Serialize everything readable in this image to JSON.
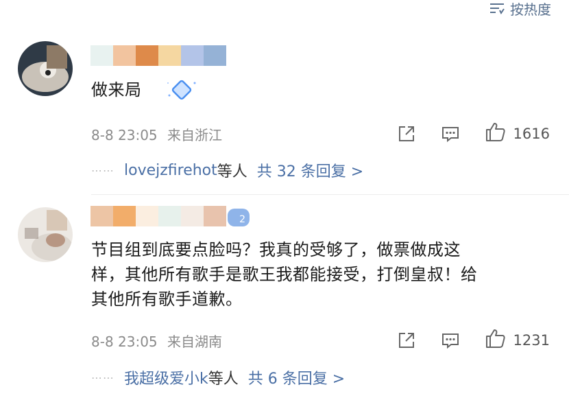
{
  "sort": {
    "label": "按热度",
    "icon": "sort-lines-icon"
  },
  "comments": [
    {
      "avatar_colors": [
        "#2f3a46",
        "#c9c2b8",
        "#8d7a66"
      ],
      "mosaic_colors": [
        "#e8f2f0",
        "#f2c49f",
        "#de8a4a",
        "#f5d7a1",
        "#b3c4e8",
        "#95b2d6"
      ],
      "text": "做来局",
      "sticker": "diamond-sticker-icon",
      "time": "8-8 23:05",
      "location": "来自浙江",
      "likes": "1616",
      "reply": {
        "dots": "⋯⋯",
        "names": "lovejzfirehot",
        "suffix": "等人",
        "total": "共 32 条回复 >"
      }
    },
    {
      "avatar_colors": [
        "#dcd6cf",
        "#b79683",
        "#6e5a4c"
      ],
      "mosaic_colors": [
        "#edc5a5",
        "#f2ad6a",
        "#fbeee0",
        "#e7f1ec",
        "#f4ebe4",
        "#e8c3ad"
      ],
      "badge": "2",
      "lines": [
        "节目组到底要点脸吗？我真的受够了，做票做成这",
        "样，其他所有歌手是歌王我都能接受，打倒皇叔！给",
        "其他所有歌手道歉。"
      ],
      "time": "8-8 23:05",
      "location": "来自湖南",
      "likes": "1231",
      "reply": {
        "dots": "⋯⋯",
        "names": "我超级爱小k",
        "suffix": "等人",
        "total": "共 6 条回复 >"
      }
    }
  ]
}
